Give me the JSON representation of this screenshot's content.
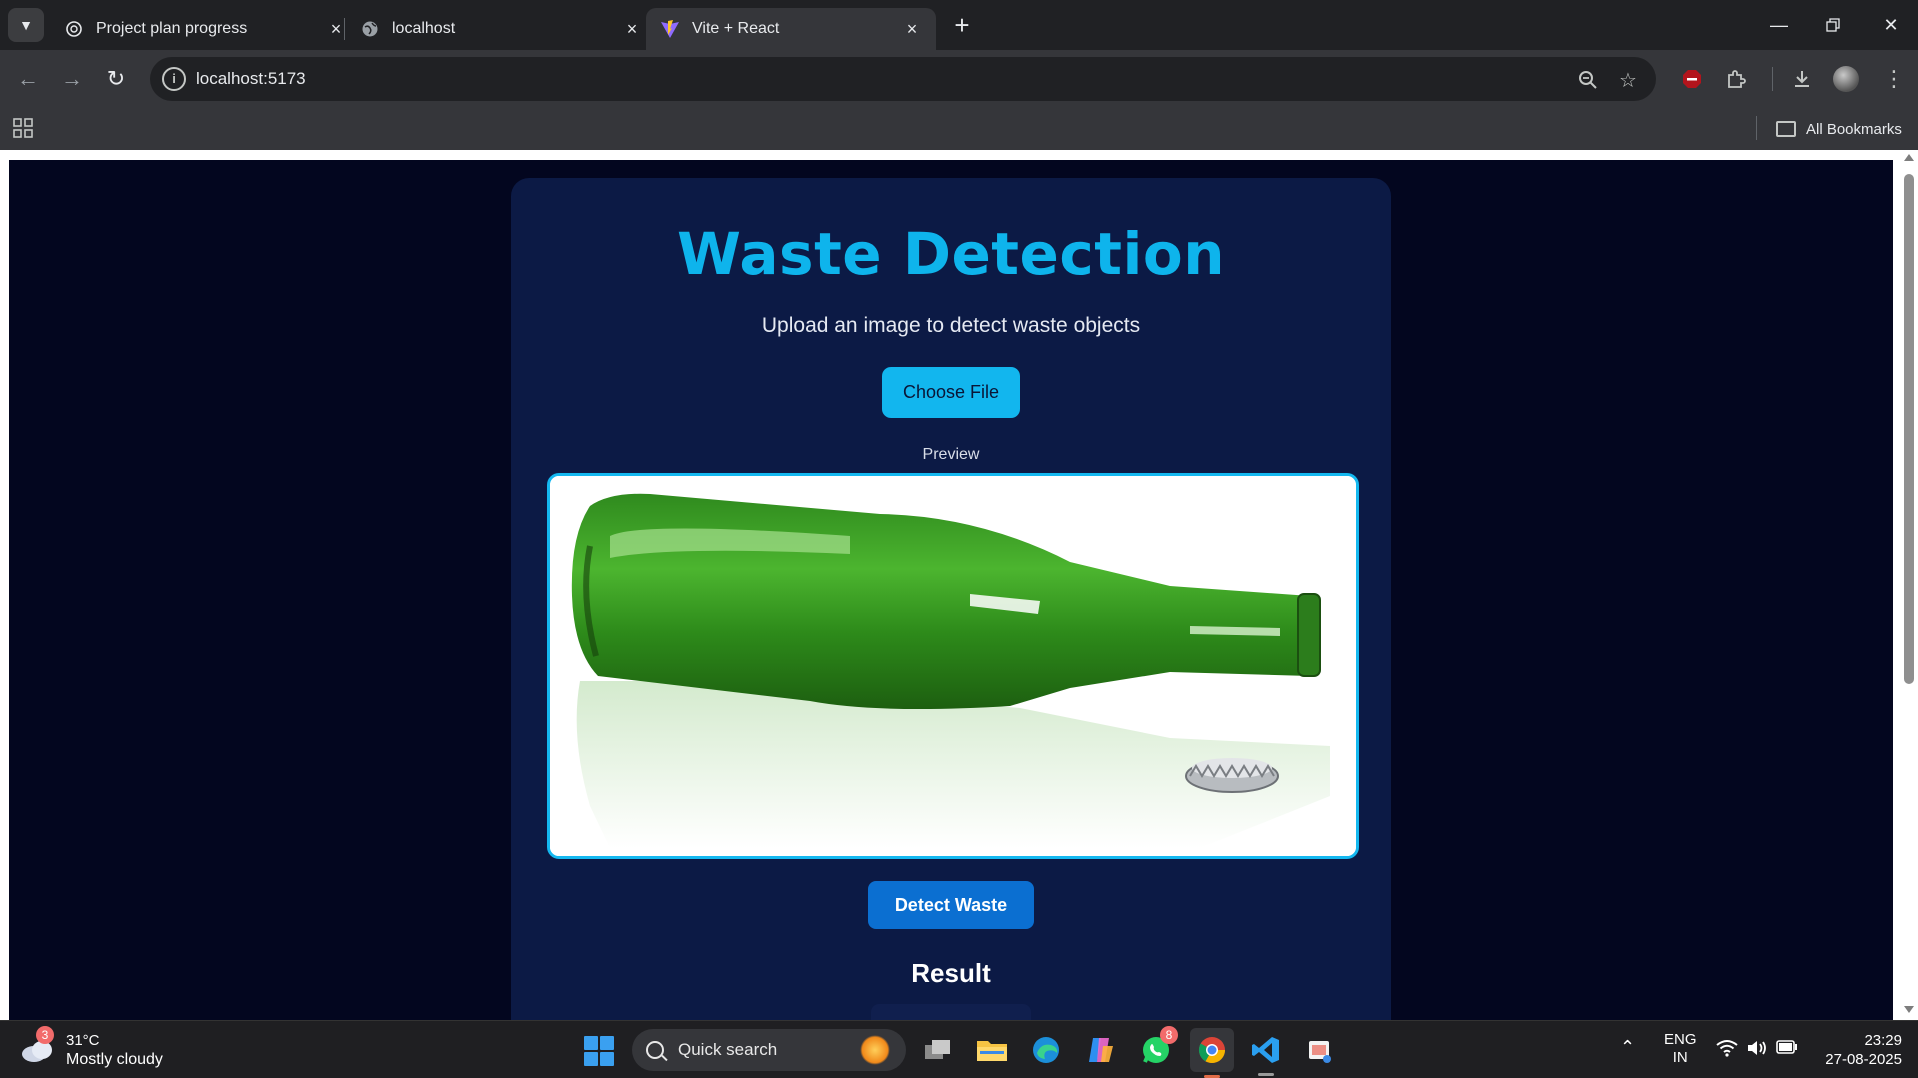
{
  "browser": {
    "tabs": [
      {
        "title": "Project plan progress",
        "icon": "openai-icon"
      },
      {
        "title": "localhost",
        "icon": "globe-icon"
      },
      {
        "title": "Vite + React",
        "icon": "vite-icon",
        "active": true
      }
    ],
    "url": "localhost:5173",
    "bookmarks_label": "All Bookmarks"
  },
  "app": {
    "title": "Waste Detection",
    "subtitle": "Upload an image to detect waste objects",
    "choose_file_label": "Choose File",
    "preview_label": "Preview",
    "preview_image": "green-glass-bottle-with-cap",
    "detect_button_label": "Detect Waste",
    "result_heading": "Result",
    "colors": {
      "page_bg": "#03061f",
      "card_bg": "#0c1a45",
      "accent": "#0eb4ec",
      "detect_button": "#0b6fd1"
    }
  },
  "taskbar": {
    "weather": {
      "temp": "31°C",
      "condition": "Mostly cloudy",
      "badge": "3"
    },
    "search_placeholder": "Quick search",
    "whatsapp_badge": "8",
    "language": {
      "line1": "ENG",
      "line2": "IN"
    },
    "time": "23:29",
    "date": "27-08-2025"
  }
}
